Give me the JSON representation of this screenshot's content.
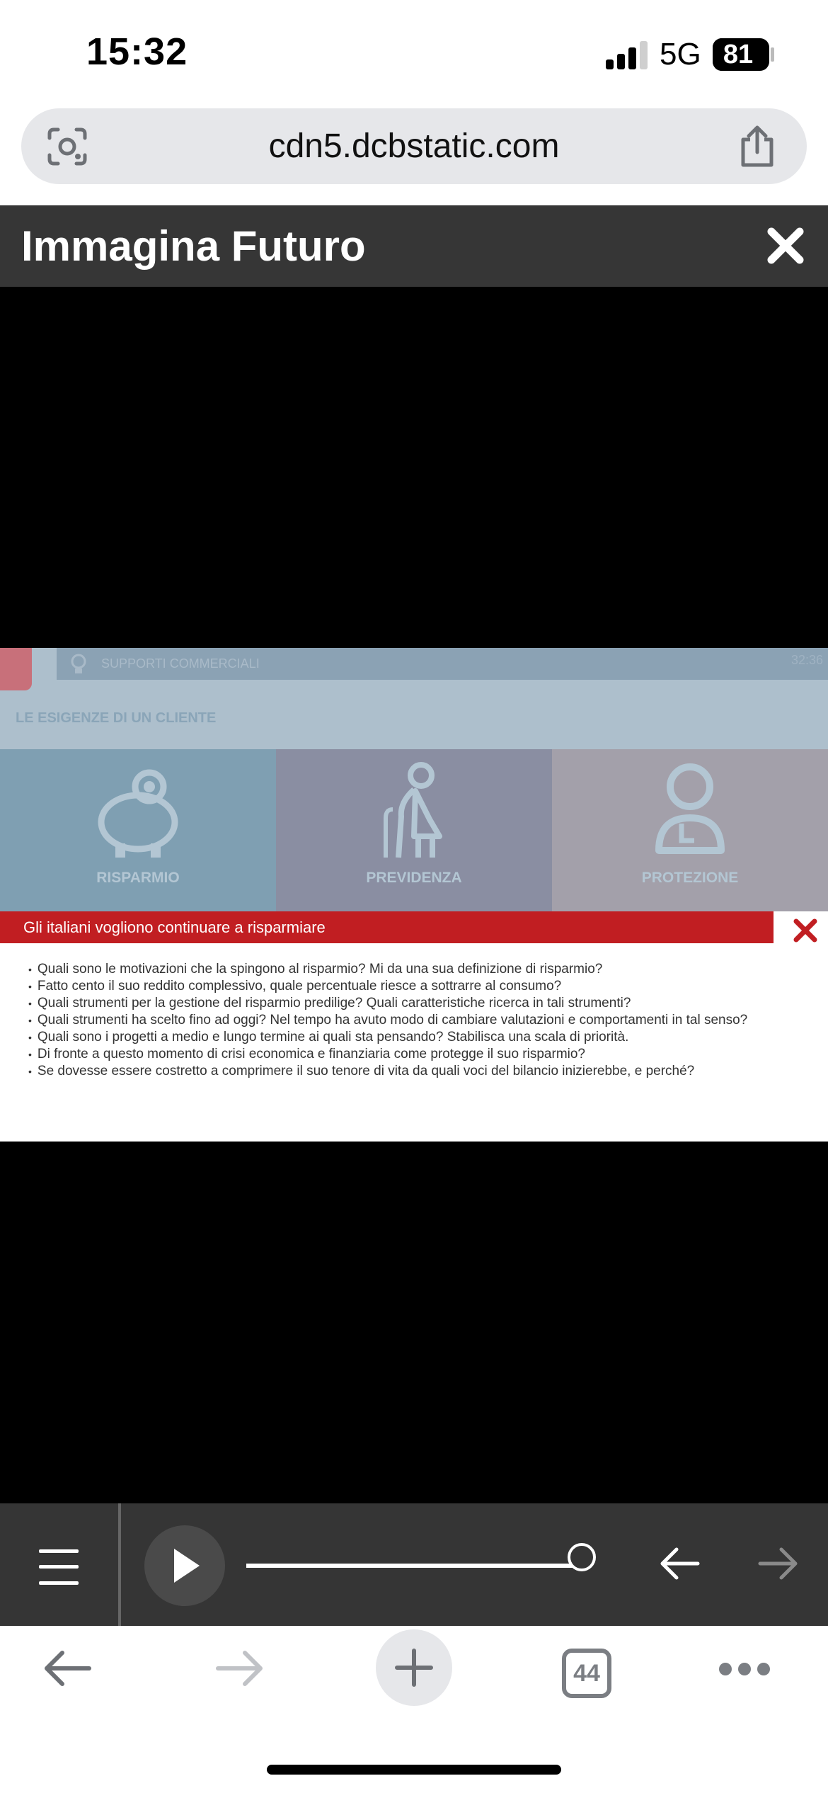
{
  "status_bar": {
    "time": "15:32",
    "network": "5G",
    "battery": "81",
    "icons": [
      "signal-icon",
      "battery-icon"
    ]
  },
  "browser": {
    "url": "cdn5.dcbstatic.com",
    "tab_count": "44",
    "icons": [
      "lens-icon",
      "share-icon",
      "back-arrow-icon",
      "forward-arrow-icon",
      "plus-icon",
      "more-icon"
    ]
  },
  "app": {
    "title": "Immagina Futuro",
    "close_icon": "close-icon"
  },
  "slide": {
    "topbar_label": "SUPPORTI COMMERCIALI",
    "time": "32:36",
    "subtitle": "LE ESIGENZE DI UN CLIENTE",
    "tiles": [
      {
        "label": "RISPARMIO",
        "icon": "piggy-bank-icon",
        "color": "#7f9fb2"
      },
      {
        "label": "PREVIDENZA",
        "icon": "elderly-person-icon",
        "color": "#8a8ea2"
      },
      {
        "label": "PROTEZIONE",
        "icon": "doctor-icon",
        "color": "#a3a0aa"
      }
    ]
  },
  "popup": {
    "title": "Gli italiani vogliono continuare a risparmiare",
    "accent": "#c11e22",
    "items": [
      "Quali sono le motivazioni che la spingono al risparmio? Mi da una sua definizione di risparmio?",
      "Fatto cento il suo reddito complessivo, quale percentuale riesce a sottrarre al consumo?",
      "Quali strumenti per la gestione del risparmio predilige? Quali caratteristiche ricerca in tali strumenti?",
      "Quali strumenti ha scelto fino ad oggi? Nel tempo ha avuto modo di cambiare valutazioni e comportamenti in tal senso?",
      "Quali sono i progetti a medio e lungo termine ai quali sta pensando? Stabilisca una scala di priorità.",
      "Di fronte a questo momento di crisi economica e finanziaria come protegge il suo risparmio?",
      "Se dovesse essere costretto a comprimere il suo tenore di vita da quali voci del bilancio inizierebbe, e perché?"
    ]
  },
  "player": {
    "progress": 0.98,
    "icons": [
      "menu-icon",
      "play-icon",
      "prev-arrow-icon",
      "next-arrow-icon"
    ]
  }
}
